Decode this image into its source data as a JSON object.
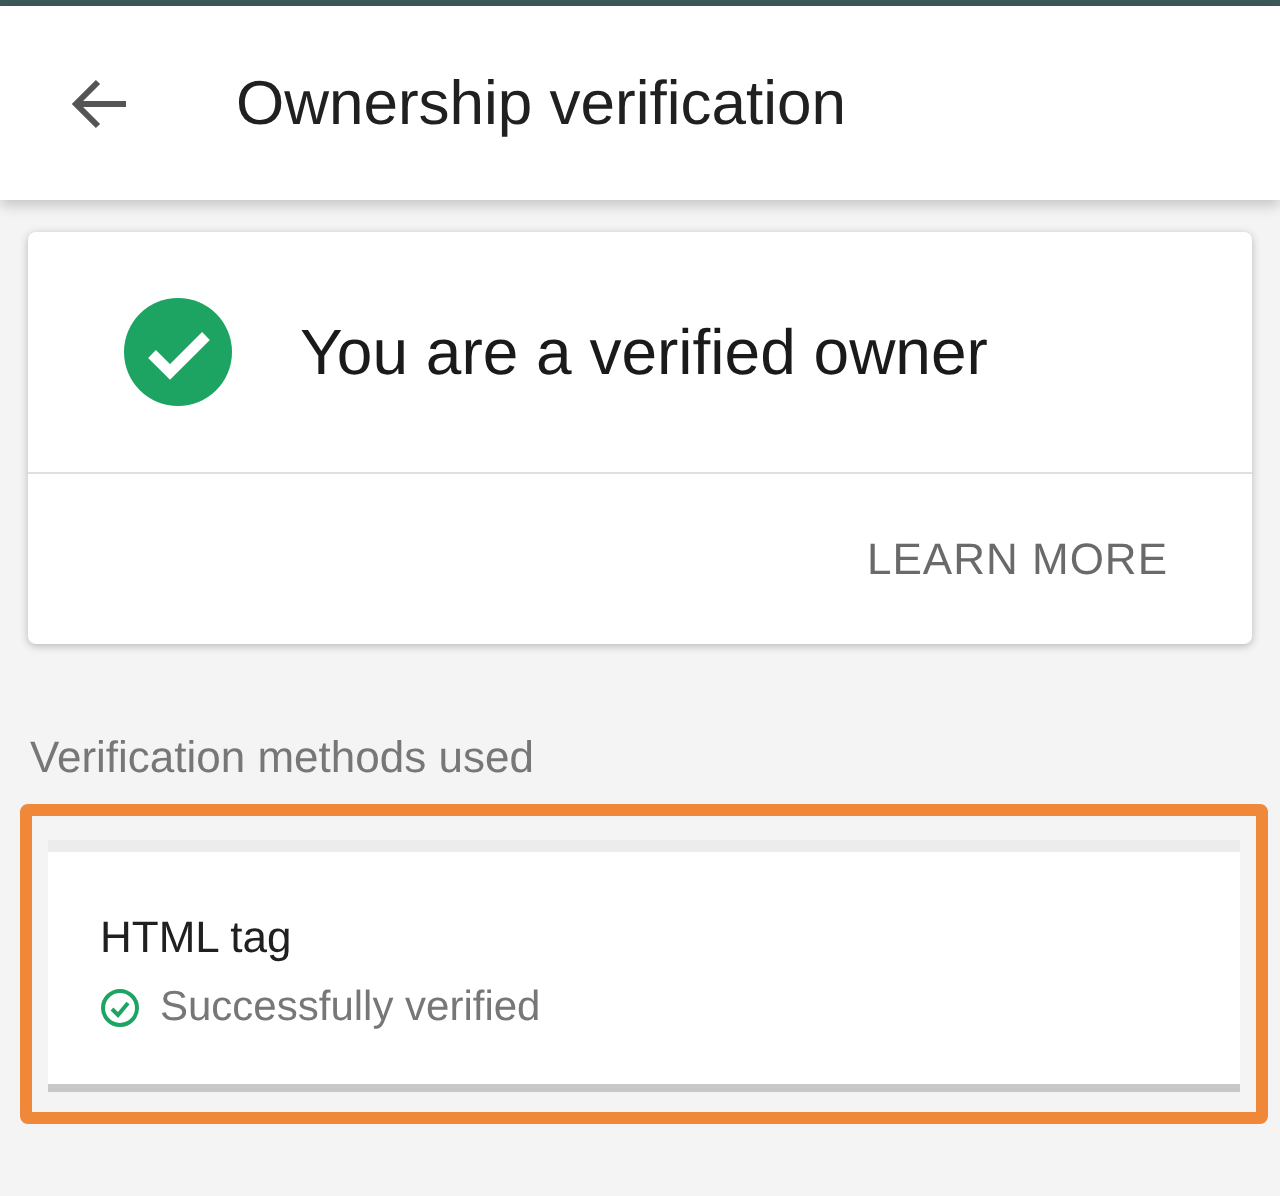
{
  "header": {
    "title": "Ownership verification"
  },
  "status_card": {
    "message": "You are a verified owner",
    "verified": true,
    "action": "LEARN MORE"
  },
  "section_label": "Verification methods used",
  "methods": [
    {
      "name": "HTML tag",
      "status": "Successfully verified",
      "verified": true,
      "highlighted": true
    }
  ]
}
